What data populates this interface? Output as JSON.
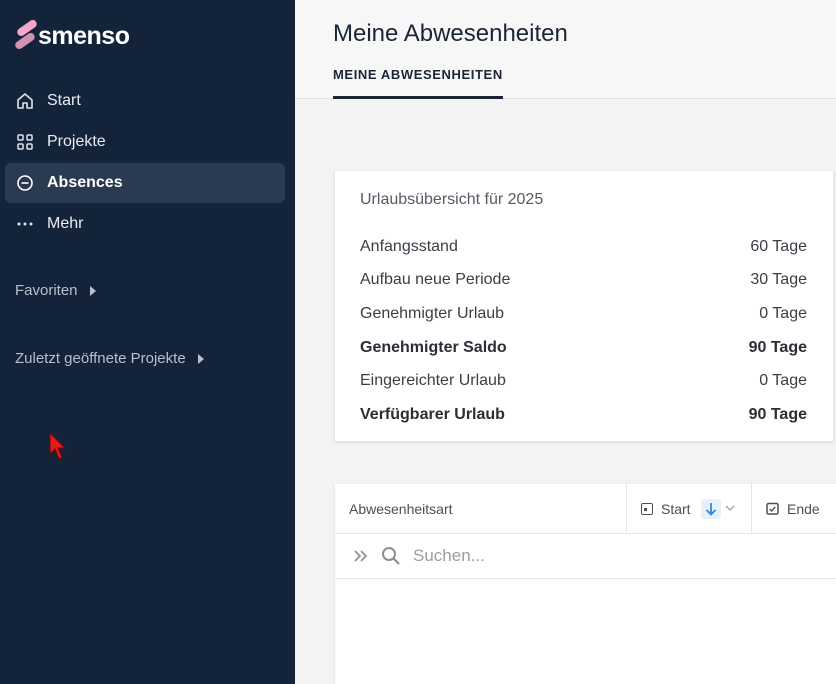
{
  "brand": {
    "name": "smenso"
  },
  "sidebar": {
    "items": [
      {
        "label": "Start",
        "icon": "home-icon"
      },
      {
        "label": "Projekte",
        "icon": "grid-icon"
      },
      {
        "label": "Absences",
        "icon": "minus-circle-icon",
        "active": true
      },
      {
        "label": "Mehr",
        "icon": "more-dots-icon"
      }
    ],
    "favorites_label": "Favoriten",
    "recent_label": "Zuletzt geöffnete Projekte"
  },
  "header": {
    "title": "Meine Abwesenheiten",
    "tab_label": "MEINE ABWESENHEITEN"
  },
  "summary": {
    "title": "Urlaubsübersicht für 2025",
    "rows": [
      {
        "label": "Anfangsstand",
        "value": "60 Tage",
        "bold": false
      },
      {
        "label": "Aufbau neue Periode",
        "value": "30 Tage",
        "bold": false
      },
      {
        "label": "Genehmigter Urlaub",
        "value": "0 Tage",
        "bold": false
      },
      {
        "label": "Genehmigter Saldo",
        "value": "90 Tage",
        "bold": true
      },
      {
        "label": "Eingereichter Urlaub",
        "value": "0 Tage",
        "bold": false
      },
      {
        "label": "Verfügbarer Urlaub",
        "value": "90 Tage",
        "bold": true
      }
    ]
  },
  "table": {
    "columns": {
      "type": "Abwesenheitsart",
      "start": "Start",
      "end": "Ende"
    },
    "search_placeholder": "Suchen..."
  },
  "colors": {
    "sidebar_bg": "#13243a",
    "active_item_bg": "#2a3a51",
    "logo_accent": "#f6a6c8",
    "sort_accent": "#2d8ae0"
  }
}
